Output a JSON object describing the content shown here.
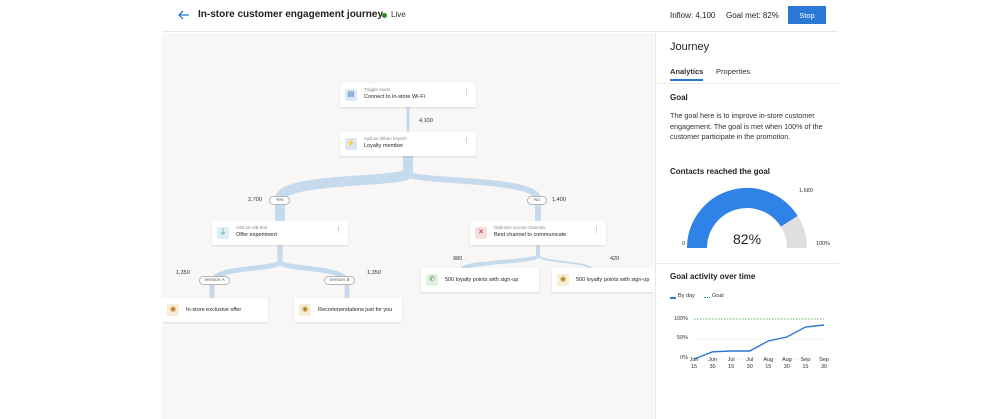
{
  "header": {
    "title": "In-store customer engagement journey",
    "status": "Live",
    "inflow": "Inflow: 4,100",
    "goal_met": "Goal met: 82%",
    "stop_label": "Stop"
  },
  "canvas": {
    "nodes": {
      "trigger": {
        "sub": "Trigger event",
        "main": "Connect to in-store Wi-Fi"
      },
      "branch": {
        "sub": "Add an if/then branch",
        "main": "Loyalty member"
      },
      "ab": {
        "sub": "Add an A/B test",
        "main": "Offer experiment"
      },
      "optimize": {
        "sub": "Optimize across channels",
        "main": "Best channel to communicate"
      },
      "offer": {
        "main": "In-store exclusive offer"
      },
      "recs": {
        "main": "Recommendations just for you"
      },
      "loyalty1": {
        "main": "500 loyalty points with sign-up"
      },
      "loyalty2": {
        "main": "500 loyalty points with sign-up"
      }
    },
    "counts": {
      "trigger_out": "4,100",
      "yes": "2,700",
      "no": "1,400",
      "version_a": "1,350",
      "version_b": "1,350",
      "whatsapp": "980",
      "other": "420"
    },
    "pills": {
      "yes": "Yes",
      "no": "No",
      "version_a": "Version A",
      "version_b": "Version B"
    }
  },
  "panel": {
    "title": "Journey",
    "tabs": [
      "Analytics",
      "Properties"
    ],
    "active_tab": "Analytics",
    "goal_heading": "Goal",
    "goal_text": "The goal here is to improve in-store customer engagement. The goal is met when 100% of the customer participate in the promotion.",
    "contacts_heading": "Contacts reached the goal",
    "gauge": {
      "value_fraction": 0.82,
      "label": "82%",
      "min_label": "0",
      "max_label": "100%",
      "target_label": "1,680"
    },
    "activity_heading": "Goal activity over time",
    "legend": {
      "by_day": "By day",
      "goal": "Goal"
    }
  },
  "chart_data": {
    "type": "line",
    "title": "Goal activity over time",
    "x": [
      "Jun 15",
      "Jun 30",
      "Jul 15",
      "Jul 30",
      "Aug 15",
      "Aug 30",
      "Sep 15",
      "Sep 30"
    ],
    "series": [
      {
        "name": "By day",
        "values": [
          0,
          18,
          20,
          20,
          45,
          55,
          80,
          85
        ]
      },
      {
        "name": "Goal",
        "values": [
          100,
          100,
          100,
          100,
          100,
          100,
          100,
          100
        ]
      }
    ],
    "y_ticks": [
      "100%",
      "50%",
      "0%"
    ],
    "ylim": [
      0,
      100
    ],
    "colors": {
      "by_day": "#2b77d4",
      "goal": "#3da33d"
    },
    "grid": true
  },
  "colors": {
    "accent": "#2b77d4",
    "live": "#2c8a2c",
    "gauge_fill": "#2f82e6",
    "gauge_track": "#e1dfdd",
    "connector": "#c6daee"
  },
  "icons": {
    "back": "back-arrow-icon",
    "trigger": "wifi-event-icon",
    "branch": "branch-icon",
    "ab": "ab-test-icon",
    "optimize": "channel-optimize-icon",
    "whatsapp": "whatsapp-icon",
    "offer": "custom-channel-icon"
  }
}
